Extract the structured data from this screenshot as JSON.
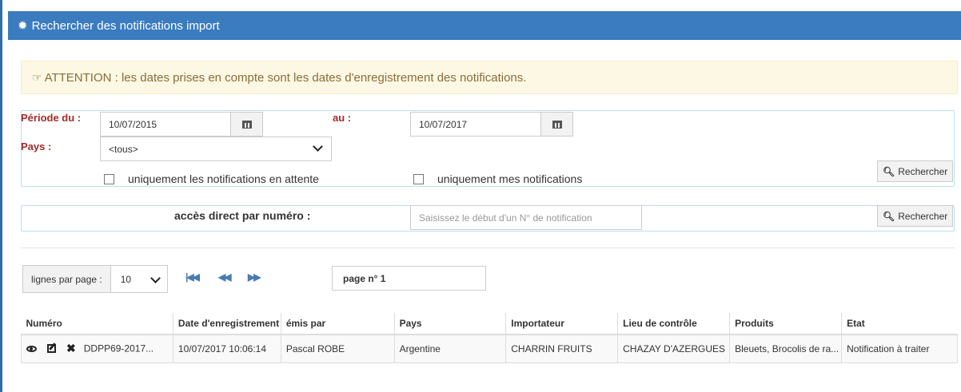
{
  "header": {
    "title": "Rechercher des notifications import",
    "icon": "gear-icon"
  },
  "alert": {
    "text": "ATTENTION : les dates prises en compte sont les dates d'enregistrement des notifications.",
    "icon": "hand-pointer-icon"
  },
  "search": {
    "period_label": "Période du :",
    "date_from": "10/07/2015",
    "to_label": "au :",
    "date_to": "10/07/2017",
    "country_label": "Pays :",
    "country_value": "<tous>",
    "check_pending": "uniquement les notifications en attente",
    "check_mine": "uniquement mes notifications",
    "search_button": "Rechercher"
  },
  "direct": {
    "label": "accès direct par numéro :",
    "placeholder": "Saisissez le début d'un N° de notification",
    "search_button": "Rechercher"
  },
  "pager": {
    "rows_label": "lignes par page :",
    "rows_value": "10",
    "page_label": "page n° 1"
  },
  "table": {
    "headers": [
      "Numéro",
      "Date d'enregistrement",
      "émis par",
      "Pays",
      "Importateur",
      "Lieu de contrôle",
      "Produits",
      "Etat"
    ],
    "rows": [
      [
        "DDPP69-2017...",
        "10/07/2017 10:06:14",
        "Pascal ROBE",
        "Argentine",
        "CHARRIN FRUITS",
        "CHAZAY D'AZERGUES",
        "Bleuets, Brocolis de ra...",
        "Notification à traiter"
      ]
    ]
  },
  "colors": {
    "header_bg": "#3b7bbf",
    "label_red": "#a52a2a",
    "alert_bg": "#fcf8e3",
    "alert_text": "#8a6d3b"
  }
}
